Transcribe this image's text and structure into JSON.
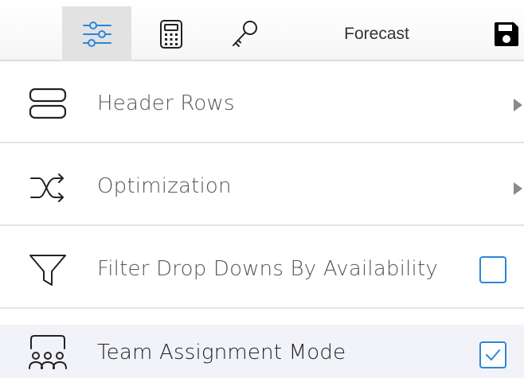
{
  "toolbar": {
    "buttons": [
      {
        "icon": "sliders-icon",
        "active": true
      },
      {
        "icon": "calculator-icon",
        "active": false
      },
      {
        "icon": "key-icon",
        "active": false
      }
    ],
    "forecast_label": "Forecast",
    "save_icon": "floppy-disk-icon"
  },
  "menu": {
    "items": [
      {
        "label": "Header Rows",
        "icon": "header-rows-icon",
        "control": "submenu"
      },
      {
        "label": "Optimization",
        "icon": "shuffle-icon",
        "control": "submenu"
      },
      {
        "label": "Filter Drop Downs By Availability",
        "icon": "filter-icon",
        "control": "checkbox",
        "checked": false
      },
      {
        "label": "Team Assignment Mode",
        "icon": "team-icon",
        "control": "checkbox",
        "checked": true
      }
    ]
  },
  "colors": {
    "accent": "#2b87d8",
    "active_tab_bg": "#e2e2e2",
    "highlight_row_bg": "#f2f3f8",
    "label_text": "#555555"
  }
}
